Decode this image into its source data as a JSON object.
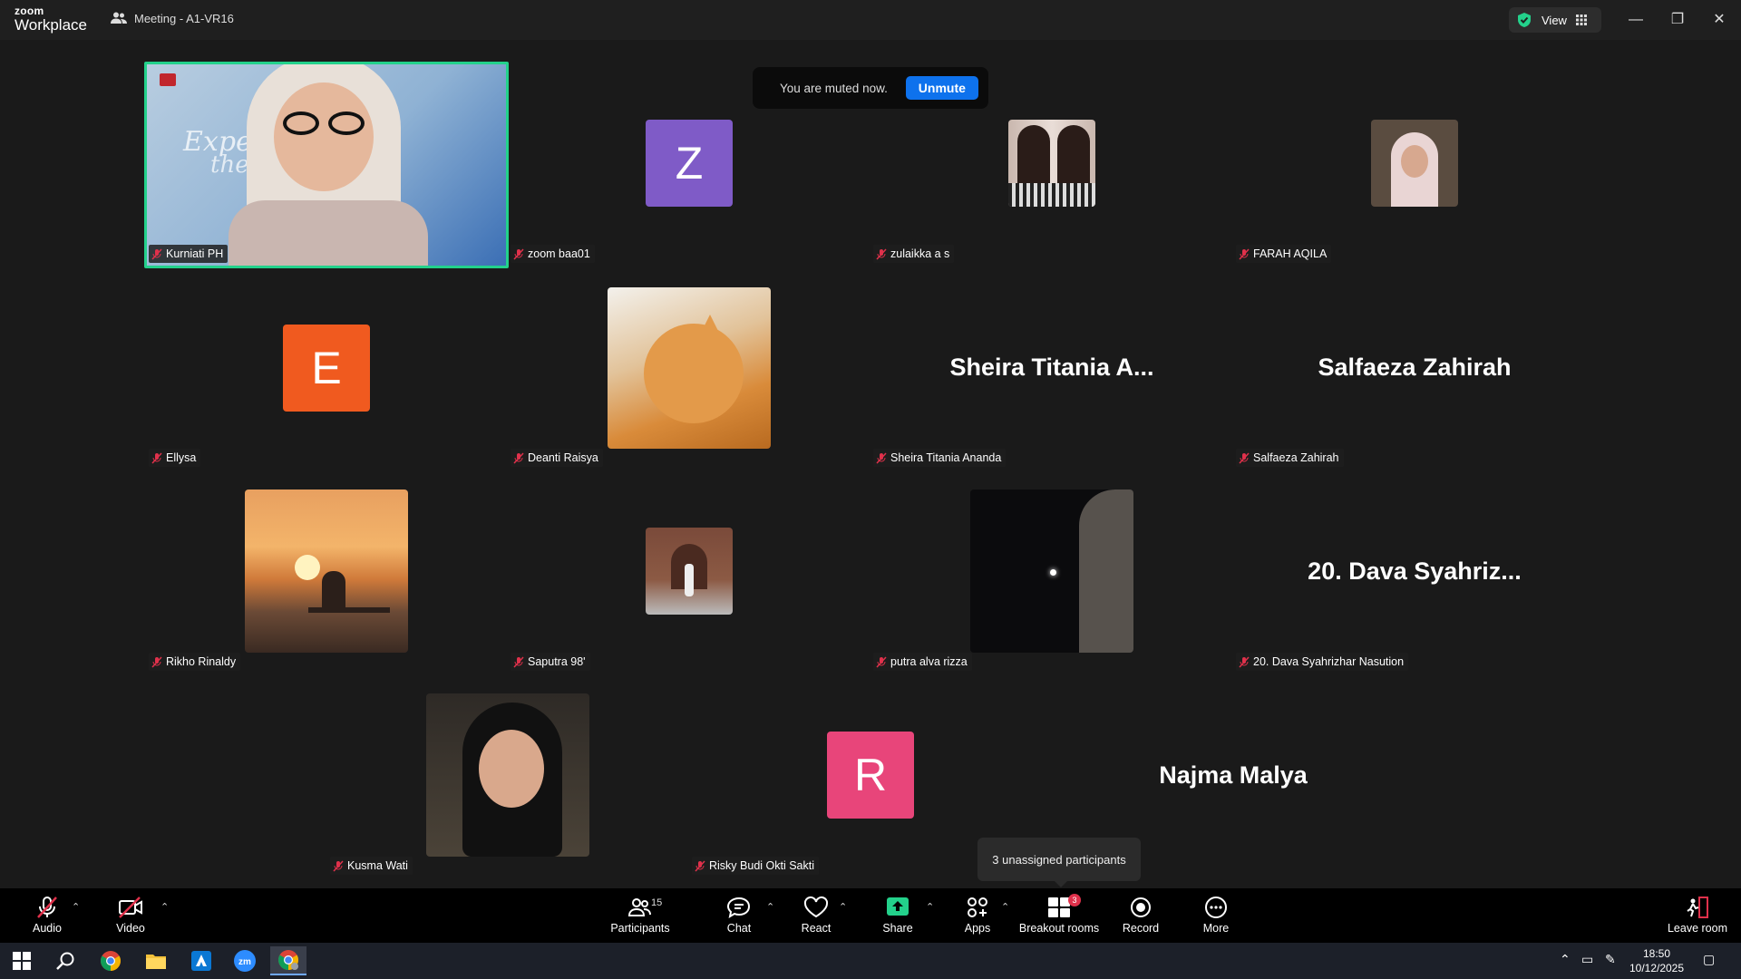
{
  "window": {
    "brand_top": "zoom",
    "brand_bottom": "Workplace",
    "meeting_title": "Meeting - A1-VR16",
    "view_label": "View",
    "controls": {
      "minimize": "—",
      "restore": "❐",
      "close": "✕"
    }
  },
  "banner": {
    "text": "You are muted now.",
    "button": "Unmute"
  },
  "tiles": [
    {
      "name": "Kurniati PH",
      "type": "video",
      "active_speaker": true
    },
    {
      "name": "zoom baa01",
      "type": "avatar",
      "initial": "Z",
      "color": "#7f5bc7"
    },
    {
      "name": "zulaikka a s",
      "type": "photo"
    },
    {
      "name": "FARAH AQILA",
      "type": "photo"
    },
    {
      "name": "Ellysa",
      "type": "avatar",
      "initial": "E",
      "color": "#f05a1f"
    },
    {
      "name": "Deanti Raisya",
      "type": "photo"
    },
    {
      "name": "Sheira Titania Ananda",
      "type": "name",
      "display": "Sheira Titania A..."
    },
    {
      "name": "Salfaeza Zahirah",
      "type": "name",
      "display": "Salfaeza Zahirah"
    },
    {
      "name": "Rikho Rinaldy",
      "type": "photo"
    },
    {
      "name": "Saputra 98'",
      "type": "photo"
    },
    {
      "name": "putra alva rizza",
      "type": "photo"
    },
    {
      "name": "20. Dava Syahrizhar Nasution",
      "type": "name",
      "display": "20. Dava Syahriz..."
    },
    {
      "name": "Kusma Wati",
      "type": "photo"
    },
    {
      "name": "Risky Budi Okti Sakti",
      "type": "avatar",
      "initial": "R",
      "color": "#e8457a"
    },
    {
      "name": "Najma Malya",
      "type": "name",
      "display": "Najma Malya"
    }
  ],
  "video_overlay": {
    "line1": "Experience",
    "line2": "the real t"
  },
  "tooltip": "3 unassigned participants",
  "toolbar": {
    "audio": "Audio",
    "video": "Video",
    "participants": "Participants",
    "participants_count": "15",
    "chat": "Chat",
    "react": "React",
    "share": "Share",
    "apps": "Apps",
    "breakout": "Breakout rooms",
    "breakout_badge": "3",
    "record": "Record",
    "more": "More",
    "leave": "Leave room"
  },
  "taskbar": {
    "time": "18:50",
    "date": "10/12/2025"
  },
  "colors": {
    "accent": "#0e72ed",
    "speaker_border": "#23d18b",
    "mute_red": "#e0314b",
    "share_green": "#23d18b"
  }
}
